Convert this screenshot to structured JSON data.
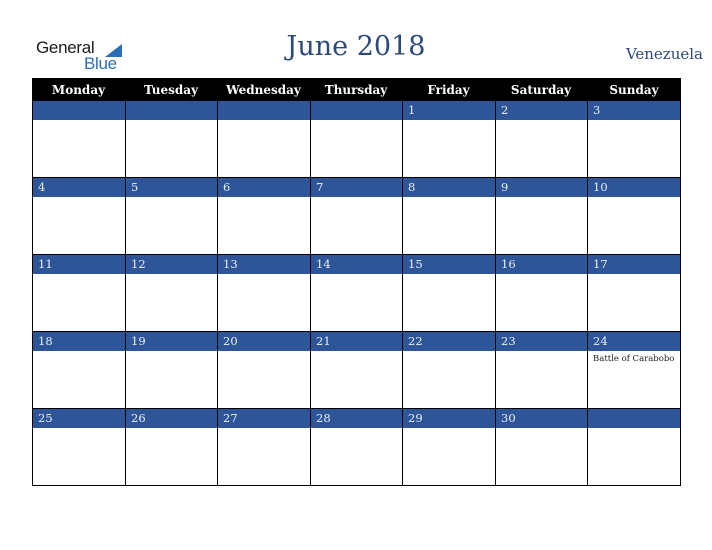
{
  "logo": {
    "word1": "General",
    "word2": "Blue"
  },
  "header": {
    "title": "June 2018",
    "country": "Venezuela"
  },
  "colors": {
    "band": "#2e5597",
    "header_bg": "#000000",
    "title": "#2b4a7a",
    "logo_blue": "#2a6fb6"
  },
  "weekdays": [
    "Monday",
    "Tuesday",
    "Wednesday",
    "Thursday",
    "Friday",
    "Saturday",
    "Sunday"
  ],
  "weeks": [
    [
      {
        "day": ""
      },
      {
        "day": ""
      },
      {
        "day": ""
      },
      {
        "day": ""
      },
      {
        "day": "1"
      },
      {
        "day": "2"
      },
      {
        "day": "3"
      }
    ],
    [
      {
        "day": "4"
      },
      {
        "day": "5"
      },
      {
        "day": "6"
      },
      {
        "day": "7"
      },
      {
        "day": "8"
      },
      {
        "day": "9"
      },
      {
        "day": "10"
      }
    ],
    [
      {
        "day": "11"
      },
      {
        "day": "12"
      },
      {
        "day": "13"
      },
      {
        "day": "14"
      },
      {
        "day": "15"
      },
      {
        "day": "16"
      },
      {
        "day": "17"
      }
    ],
    [
      {
        "day": "18"
      },
      {
        "day": "19"
      },
      {
        "day": "20"
      },
      {
        "day": "21"
      },
      {
        "day": "22"
      },
      {
        "day": "23"
      },
      {
        "day": "24",
        "event": "Battle of Carabobo"
      }
    ],
    [
      {
        "day": "25"
      },
      {
        "day": "26"
      },
      {
        "day": "27"
      },
      {
        "day": "28"
      },
      {
        "day": "29"
      },
      {
        "day": "30"
      },
      {
        "day": ""
      }
    ]
  ]
}
